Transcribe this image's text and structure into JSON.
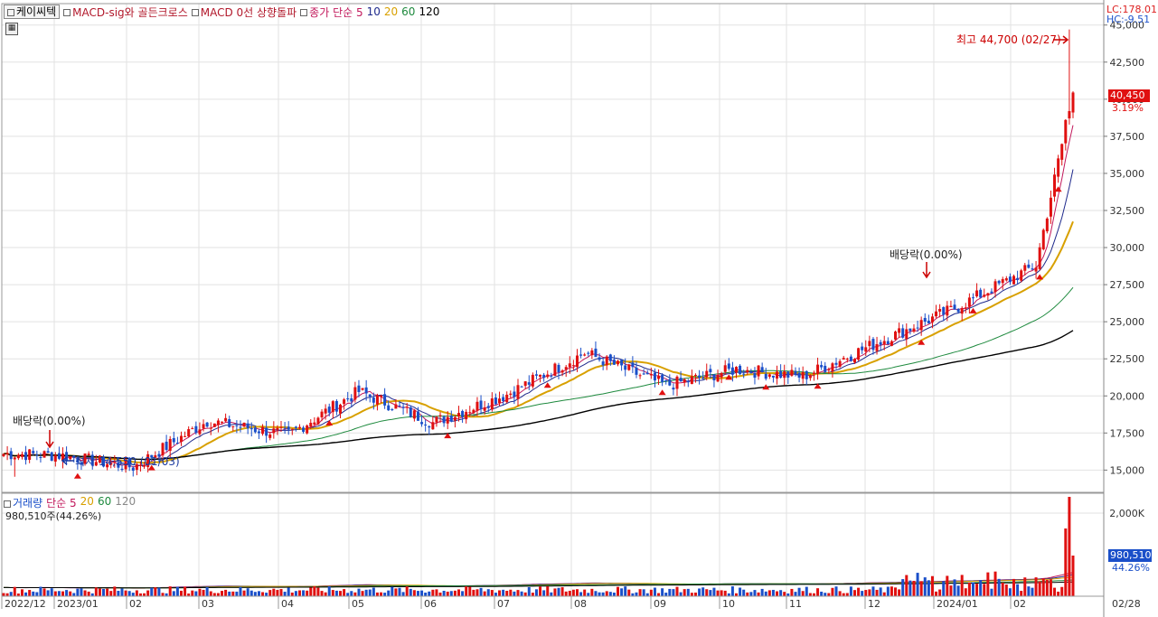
{
  "header": {
    "stock_name": "케이씨텍",
    "indicators": [
      {
        "label": "MACD-sig와 골든크로스",
        "color": "#b2182b"
      },
      {
        "label": "MACD 0선 상향돌파",
        "color": "#b2182b"
      }
    ],
    "ma_title": "종가 단순 5",
    "ma_periods": [
      "10",
      "20",
      "60",
      "120"
    ]
  },
  "right_info": {
    "lc": "LC:178.01",
    "hc": "HC:-9.51"
  },
  "price_tag": {
    "value": "40,450",
    "pct": "3.19%"
  },
  "volume_header": {
    "title": "거래량",
    "ma_title": "단순 5",
    "periods": [
      "20",
      "60",
      "120"
    ],
    "sub": "980,510주(44.26%)"
  },
  "volume_tag": {
    "value": "980,510",
    "pct": "44.26%"
  },
  "colors": {
    "up": "#e01010",
    "down": "#1a4fc9",
    "ma5": "#c2185b",
    "ma10": "#1f2a8c",
    "ma20": "#d8a000",
    "ma60": "#1e8a3e",
    "ma120": "#000000",
    "grid": "#e2e2e2"
  },
  "chart_data": {
    "type": "candlestick",
    "price_axis": {
      "ticks": [
        "45,000",
        "42,500",
        "40,000",
        "37,500",
        "35,000",
        "32,500",
        "30,000",
        "27,500",
        "25,000",
        "22,500",
        "20,000",
        "17,500",
        "15,000"
      ],
      "ylim": [
        13500,
        46200
      ]
    },
    "volume_axis": {
      "ticks": [
        "2,000K"
      ]
    },
    "x_axis": {
      "labels": [
        "2022/12",
        "2023/01",
        "02",
        "03",
        "04",
        "05",
        "06",
        "07",
        "08",
        "09",
        "10",
        "11",
        "12",
        "2024/01",
        "02"
      ],
      "end_label": "02/28"
    },
    "annotations": {
      "high": "최고 44,700 (02/27)",
      "low": "최저 14,550 (01/03)",
      "dividend_label": "배당락(0.00%)"
    },
    "months": [
      {
        "label": "2022/12",
        "close": 16100
      },
      {
        "label": "2023/01",
        "close": 15900
      },
      {
        "label": "02",
        "close": 18300
      },
      {
        "label": "03",
        "close": 17400
      },
      {
        "label": "04",
        "close": 20300
      },
      {
        "label": "05",
        "close": 18200
      },
      {
        "label": "06",
        "close": 20100
      },
      {
        "label": "07",
        "close": 22900
      },
      {
        "label": "08",
        "close": 20700
      },
      {
        "label": "09",
        "close": 21800
      },
      {
        "label": "10",
        "close": 21300
      },
      {
        "label": "11",
        "close": 23800
      },
      {
        "label": "12",
        "close": 25900
      },
      {
        "label": "2024/01",
        "close": 28800
      },
      {
        "label": "02",
        "close": 40450
      }
    ]
  }
}
